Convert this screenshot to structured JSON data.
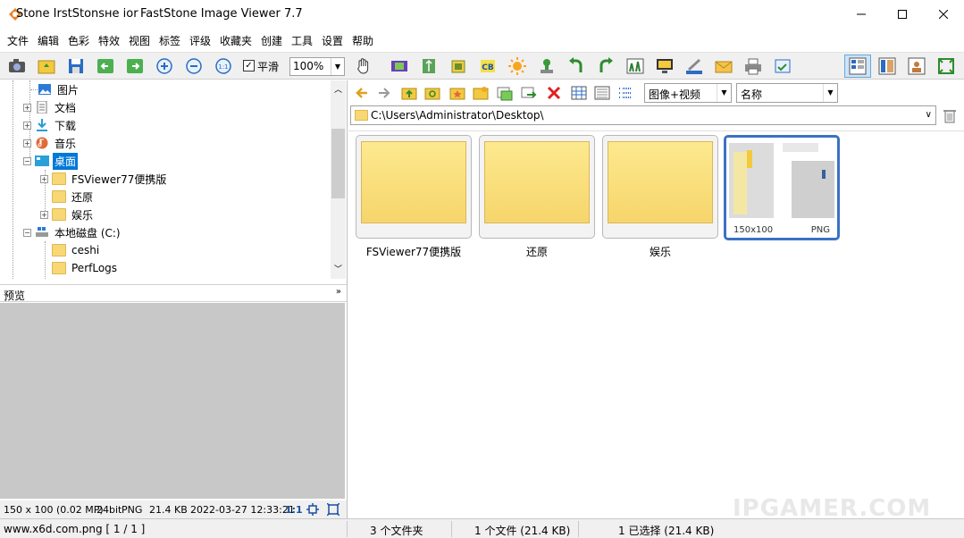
{
  "window": {
    "left_title": "Stone IrstStonsнe ior",
    "title": "FastStone Image Viewer 7.7"
  },
  "menu": [
    "文件",
    "编辑",
    "色彩",
    "特效",
    "视图",
    "标签",
    "评级",
    "收藏夹",
    "创建",
    "工具",
    "设置",
    "帮助"
  ],
  "toolbar": {
    "smooth_label": "平滑",
    "smooth_checked": "✓",
    "zoom_value": "100%"
  },
  "tree": {
    "items": [
      {
        "label": "图片",
        "icon": "pictures-icon"
      },
      {
        "label": "文档",
        "icon": "documents-icon"
      },
      {
        "label": "下载",
        "icon": "downloads-icon"
      },
      {
        "label": "音乐",
        "icon": "music-icon"
      },
      {
        "label": "桌面",
        "icon": "desktop-icon"
      },
      {
        "label": "FSViewer77便携版",
        "icon": "folder-icon"
      },
      {
        "label": "还原",
        "icon": "folder-icon"
      },
      {
        "label": "娱乐",
        "icon": "folder-icon"
      },
      {
        "label": "本地磁盘 (C:)",
        "icon": "drive-icon"
      },
      {
        "label": "ceshi",
        "icon": "folder-icon"
      },
      {
        "label": "PerfLogs",
        "icon": "folder-icon"
      }
    ]
  },
  "preview": {
    "header": "预览"
  },
  "info_bar": {
    "dimensions": "150 x 100 (0.02 MP)",
    "bitdepth": "24bit",
    "format": "PNG",
    "size": "21.4 KB",
    "datetime": "2022-03-27 12:33:21",
    "ratio": "1:1"
  },
  "nav": {
    "filter": "图像+视频",
    "sort": "名称",
    "path": "C:\\Users\\Administrator\\Desktop\\"
  },
  "thumbnails": [
    {
      "label": "FSViewer77便携版",
      "type": "folder"
    },
    {
      "label": "还原",
      "type": "folder"
    },
    {
      "label": "娱乐",
      "type": "folder"
    },
    {
      "label": "",
      "type": "image",
      "size": "150x100",
      "format": "PNG"
    }
  ],
  "status": {
    "file": "www.x6d.com.png [ 1 / 1 ]",
    "folders": "3 个文件夹",
    "files": "1 个文件 (21.4 KB)",
    "selected": "1 已选择 (21.4 KB)"
  },
  "watermark": "IPGAMER.COM"
}
